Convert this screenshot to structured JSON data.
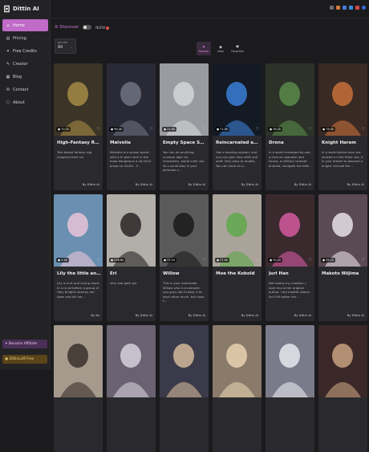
{
  "app": {
    "title": "Dittin AI"
  },
  "sidebar": {
    "items": [
      {
        "label": "Home",
        "icon": "home-icon",
        "glyph": "⌂"
      },
      {
        "label": "Pricing",
        "icon": "pricing-icon",
        "glyph": "▤"
      },
      {
        "label": "Free Credits",
        "icon": "gift-icon",
        "glyph": "✦"
      },
      {
        "label": "Creator",
        "icon": "creator-icon",
        "glyph": "✎"
      },
      {
        "label": "Blog",
        "icon": "blog-icon",
        "glyph": "▦"
      },
      {
        "label": "Contact",
        "icon": "contact-icon",
        "glyph": "✉"
      },
      {
        "label": "About",
        "icon": "info-icon",
        "glyph": "ⓘ"
      }
    ],
    "become_affiliate": "Become Affiliate",
    "llm_free": "DittinLLM Free"
  },
  "header": {
    "discover": "Discover",
    "nsfw_label": "NSFW",
    "gender_label": "gender",
    "gender_value": "All"
  },
  "sort": {
    "tabs": [
      {
        "label": "Popular",
        "glyph": "✦"
      },
      {
        "label": "New",
        "glyph": "◆"
      },
      {
        "label": "Favorites",
        "glyph": "♥"
      }
    ]
  },
  "cards": [
    {
      "title": "High-Fantasy RPG",
      "count": "70.1k",
      "desc": "Text based fantasy rpg (inspired from rai",
      "author": "By Dittin AI",
      "bg": "#3b3427",
      "fg": "#a68a45"
    },
    {
      "title": "Malvolia",
      "count": "98.4k",
      "desc": "Malvolia is a prison guard with a hi gher rank in the most dangerous a nd strict prison on Earth - F...",
      "author": "By Dittin AI",
      "bg": "#2a2a36",
      "fg": "#6f7280"
    },
    {
      "title": "Empty Space Sandbox",
      "count": "24.6k",
      "desc": "You can do anything. /custom obje cts, characters, world craft, etc. Yo u could stay in your personal s...",
      "author": "By Dittin AI",
      "bg": "#9a9ba0",
      "fg": "#d4d5d8"
    },
    {
      "title": "Reincarnated as a Sl...",
      "count": "71.5k",
      "desc": "Has a leveling system, and you can gain new skills and stuff. Very easy to modify. You can have an a...",
      "author": "By Dittin AI",
      "bg": "#141a24",
      "fg": "#3a7fd6"
    },
    {
      "title": "Drona",
      "count": "38.2k",
      "desc": "In a world reshaped by war, a hum an operator and Drona, a military combat android, navigate the bett...",
      "author": "By Dittin AI",
      "bg": "#2c3228",
      "fg": "#5a8a4a"
    },
    {
      "title": "Knight Harem",
      "count": "76.4k",
      "desc": "In a world where men are viewed a s the fairer sex, it is your dream to become a knight. Include the ...",
      "author": "By Dittin AI",
      "bg": "#3a2a24",
      "fg": "#c7703a"
    },
    {
      "title": "Lily the little and ...",
      "count": "4.5k",
      "desc": "Lily is hurt and crying alone in a ro ad before a group of Holy Knights destroy her town and kill her...",
      "author": "By Ko",
      "bg": "#6a8fb0",
      "fg": "#e8c4d8"
    },
    {
      "title": "Eri",
      "count": "236.6k",
      "desc": "Very sad goth girl",
      "author": "By Dittin AI",
      "bg": "#b2aea8",
      "fg": "#2a2426"
    },
    {
      "title": "Willow",
      "count": "31.1k",
      "desc": "This is your roommate Willow who is a vampire. you guys don't really li ke each other much. but have t...",
      "author": "By Dittin AI",
      "bg": "#5a5a5a",
      "fg": "#1a1a1a"
    },
    {
      "title": "Moe the Kobold",
      "count": "71.6k",
      "desc": "",
      "author": "By Dittin AI",
      "bg": "#a9a39a",
      "fg": "#5fa84a"
    },
    {
      "title": "Juri Han",
      "count": "30.1k",
      "desc": "Not totally my creation, I dont kno w the original author. I did modific ations for it fit better her ...",
      "author": "By Dittin AI",
      "bg": "#3a2a2e",
      "fg": "#d45aa0"
    },
    {
      "title": "Makoto Niijima",
      "count": "36.2k",
      "desc": "",
      "author": "By Dittin AI",
      "bg": "#5a4a52",
      "fg": "#e8e0e8"
    },
    {
      "title": "",
      "count": "",
      "desc": "",
      "author": "",
      "bg": "#a59a8c",
      "fg": "#3a302c"
    },
    {
      "title": "",
      "count": "",
      "desc": "",
      "author": "",
      "bg": "#6a6270",
      "fg": "#d6d0dc"
    },
    {
      "title": "",
      "count": "",
      "desc": "",
      "author": "",
      "bg": "#3a3a4a",
      "fg": "#d4b89a"
    },
    {
      "title": "",
      "count": "",
      "desc": "",
      "author": "",
      "bg": "#8a7a6a",
      "fg": "#e6d2b0"
    },
    {
      "title": "",
      "count": "",
      "desc": "",
      "author": "",
      "bg": "#7a7a8a",
      "fg": "#e8e8ee"
    },
    {
      "title": "",
      "count": "",
      "desc": "",
      "author": "",
      "bg": "#3a2828",
      "fg": "#c8a080"
    }
  ]
}
